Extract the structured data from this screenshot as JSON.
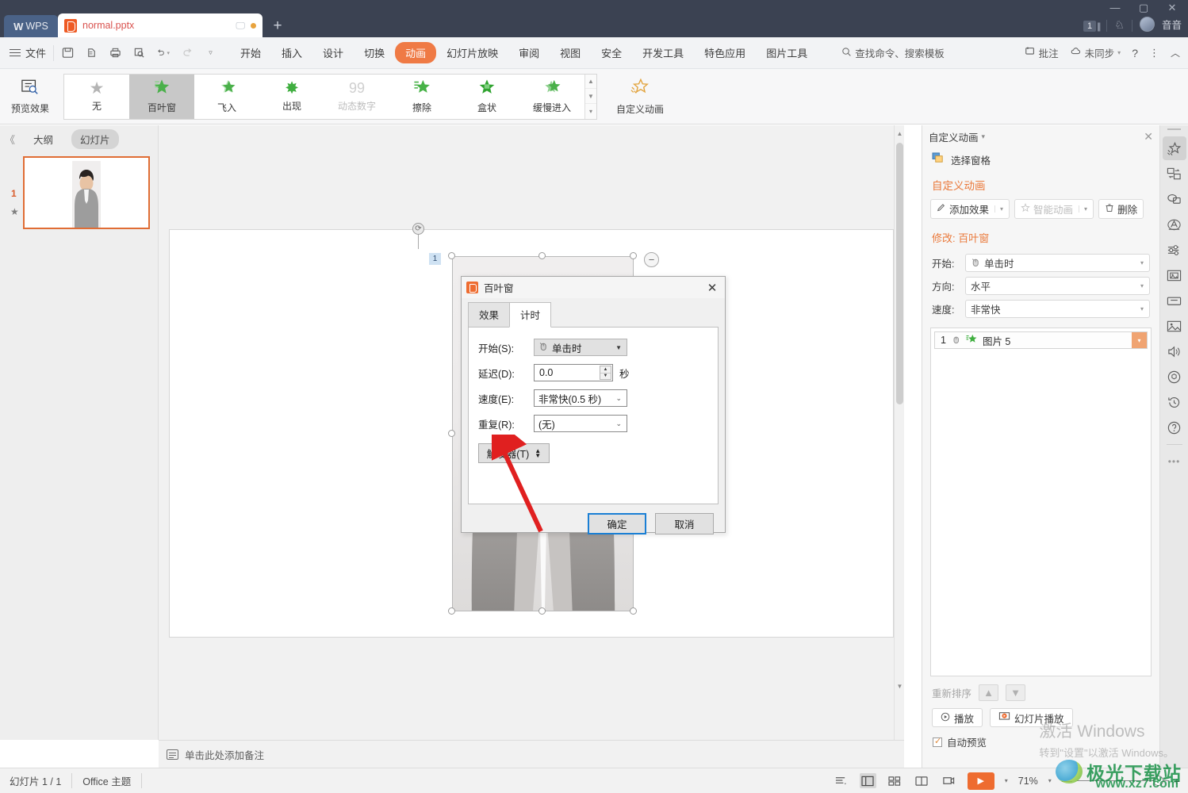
{
  "titlebar": {
    "wps_label": "WPS",
    "doc_tab": "normal.pptx",
    "new_tab": "+",
    "page_count": "1",
    "user_name": "音音",
    "min": "—",
    "max": "▢",
    "close": "✕"
  },
  "menubar": {
    "file_label": "文件",
    "quick_icons": [
      "save-icon",
      "print-preview-icon",
      "print-icon",
      "find-icon",
      "undo-icon",
      "redo-icon",
      "more-icon"
    ],
    "tabs": [
      {
        "label": "开始",
        "active": false
      },
      {
        "label": "插入",
        "active": false
      },
      {
        "label": "设计",
        "active": false
      },
      {
        "label": "切换",
        "active": false
      },
      {
        "label": "动画",
        "active": true
      },
      {
        "label": "幻灯片放映",
        "active": false
      },
      {
        "label": "审阅",
        "active": false
      },
      {
        "label": "视图",
        "active": false
      },
      {
        "label": "安全",
        "active": false
      },
      {
        "label": "开发工具",
        "active": false
      },
      {
        "label": "特色应用",
        "active": false
      },
      {
        "label": "图片工具",
        "active": false
      }
    ],
    "search_placeholder": "查找命令、搜索模板",
    "right_items": [
      {
        "label": "批注",
        "icon": "comment-icon"
      },
      {
        "label": "未同步",
        "icon": "cloud-sync-icon"
      },
      {
        "label": "?",
        "icon": "help-icon"
      },
      {
        "label": "⋮",
        "icon": "more-vert-icon"
      },
      {
        "label": "︿",
        "icon": "collapse-ribbon-icon"
      }
    ]
  },
  "ribbon": {
    "preview_label": "预览效果",
    "gallery": [
      {
        "label": "无",
        "selected": false,
        "disabled": false,
        "color": "#b4b4b4"
      },
      {
        "label": "百叶窗",
        "selected": true,
        "disabled": false,
        "color": "#4ab04a"
      },
      {
        "label": "飞入",
        "selected": false,
        "disabled": false,
        "color": "#5cbf5c"
      },
      {
        "label": "出现",
        "selected": false,
        "disabled": false,
        "color": "#3fae3f"
      },
      {
        "label": "动态数字",
        "selected": false,
        "disabled": true,
        "color": "#cfcfcf"
      },
      {
        "label": "擦除",
        "selected": false,
        "disabled": false,
        "color": "#47b247"
      },
      {
        "label": "盒状",
        "selected": false,
        "disabled": false,
        "color": "#2fa32f"
      },
      {
        "label": "缓慢进入",
        "selected": false,
        "disabled": false,
        "color": "#5cbf5c"
      }
    ],
    "custom_anim_label": "自定义动画"
  },
  "leftpanel": {
    "collapse": "《",
    "tabs": [
      {
        "label": "大纲",
        "active": false
      },
      {
        "label": "幻灯片",
        "active": true
      }
    ],
    "slide_number": "1",
    "anim_star": "★"
  },
  "canvas": {
    "anim_badge": "1",
    "minus_btn": "−",
    "rotate_icon": "rotate-icon"
  },
  "notes": {
    "placeholder": "单击此处添加备注"
  },
  "statusbar": {
    "slide_info": "幻灯片 1 / 1",
    "theme": "Office 主题",
    "view_icons": [
      "outline-view-icon",
      "normal-view-icon",
      "slide-sorter-icon",
      "reading-view-icon",
      "presenter-view-icon"
    ],
    "play_btn": "▶",
    "zoom": "71%",
    "zoom_minus": "—",
    "zoom_plus": "+"
  },
  "rightpanel": {
    "title": "自定义动画",
    "close": "✕",
    "select_pane": "选择窗格",
    "section_title": "自定义动画",
    "buttons": [
      {
        "label": "添加效果",
        "icon": "pencil-icon",
        "disabled": false,
        "caret": true
      },
      {
        "label": "智能动画",
        "icon": "magic-star-icon",
        "disabled": true,
        "caret": true
      },
      {
        "label": "删除",
        "icon": "trash-icon",
        "disabled": false,
        "caret": false
      }
    ],
    "modify_prefix": "修改:",
    "modify_effect": "百叶窗",
    "fields": [
      {
        "label": "开始:",
        "value": "单击时",
        "icon": "mouse-click-icon"
      },
      {
        "label": "方向:",
        "value": "水平",
        "icon": ""
      },
      {
        "label": "速度:",
        "value": "非常快",
        "icon": ""
      }
    ],
    "list_items": [
      {
        "index": "1",
        "icon": "mouse-click-icon",
        "effect_icon": "blinds-star-icon",
        "name": "图片 5"
      }
    ],
    "reorder_label": "重新排序",
    "reorder_up": "▲",
    "reorder_down": "▼",
    "play_label": "播放",
    "slideshow_label": "幻灯片播放",
    "autopreview_label": "自动预览"
  },
  "rail": {
    "icons": [
      {
        "name": "animation-pane-icon",
        "glyph": "✨",
        "active": true
      },
      {
        "name": "shape-swap-icon",
        "glyph": "⧉",
        "active": false
      },
      {
        "name": "speech-bubble-icon",
        "glyph": "◯",
        "active": false
      },
      {
        "name": "text-effect-icon",
        "glyph": "Ⓐ",
        "active": false
      },
      {
        "name": "adjust-sliders-icon",
        "glyph": "⚙",
        "active": false
      },
      {
        "name": "image-gallery-icon",
        "glyph": "🖼",
        "active": false
      },
      {
        "name": "box-icon",
        "glyph": "▭",
        "active": false
      },
      {
        "name": "picture-icon",
        "glyph": "⛰",
        "active": false
      },
      {
        "name": "audio-icon",
        "glyph": "🔊",
        "active": false
      },
      {
        "name": "badge-icon",
        "glyph": "✪",
        "active": false
      },
      {
        "name": "history-icon",
        "glyph": "↺",
        "active": false
      },
      {
        "name": "help-circle-icon",
        "glyph": "?",
        "active": false
      },
      {
        "name": "more-dots-icon",
        "glyph": "⋯",
        "active": false
      }
    ]
  },
  "dialog": {
    "title": "百叶窗",
    "close": "✕",
    "tabs": [
      {
        "label": "效果",
        "active": false
      },
      {
        "label": "计时",
        "active": true
      }
    ],
    "rows": [
      {
        "label": "开始(S):",
        "type": "combo-grey",
        "value": "单击时",
        "icon": "mouse-click-icon"
      },
      {
        "label": "延迟(D):",
        "type": "spinner",
        "value": "0.0",
        "unit": "秒"
      },
      {
        "label": "速度(E):",
        "type": "combo-white",
        "value": "非常快(0.5 秒)"
      },
      {
        "label": "重复(R):",
        "type": "combo-white",
        "value": "(无)"
      }
    ],
    "trigger_label": "触发器(T)",
    "ok_label": "确定",
    "cancel_label": "取消"
  },
  "watermarks": {
    "activate_line1": "激活 Windows",
    "activate_line2": "转到\"设置\"以激活 Windows。",
    "site_name": "极光下载站",
    "site_url": "www.xz7.com"
  },
  "colors": {
    "accent_orange": "#ee6c30",
    "tab_active": "#ef7a45",
    "titlebar_bg": "#3b4252",
    "panel_bg": "#f6f6f6",
    "green_star": "#4ab04a",
    "dialog_focus_blue": "#1a7fd4",
    "thumb_border": "#e06d35"
  }
}
